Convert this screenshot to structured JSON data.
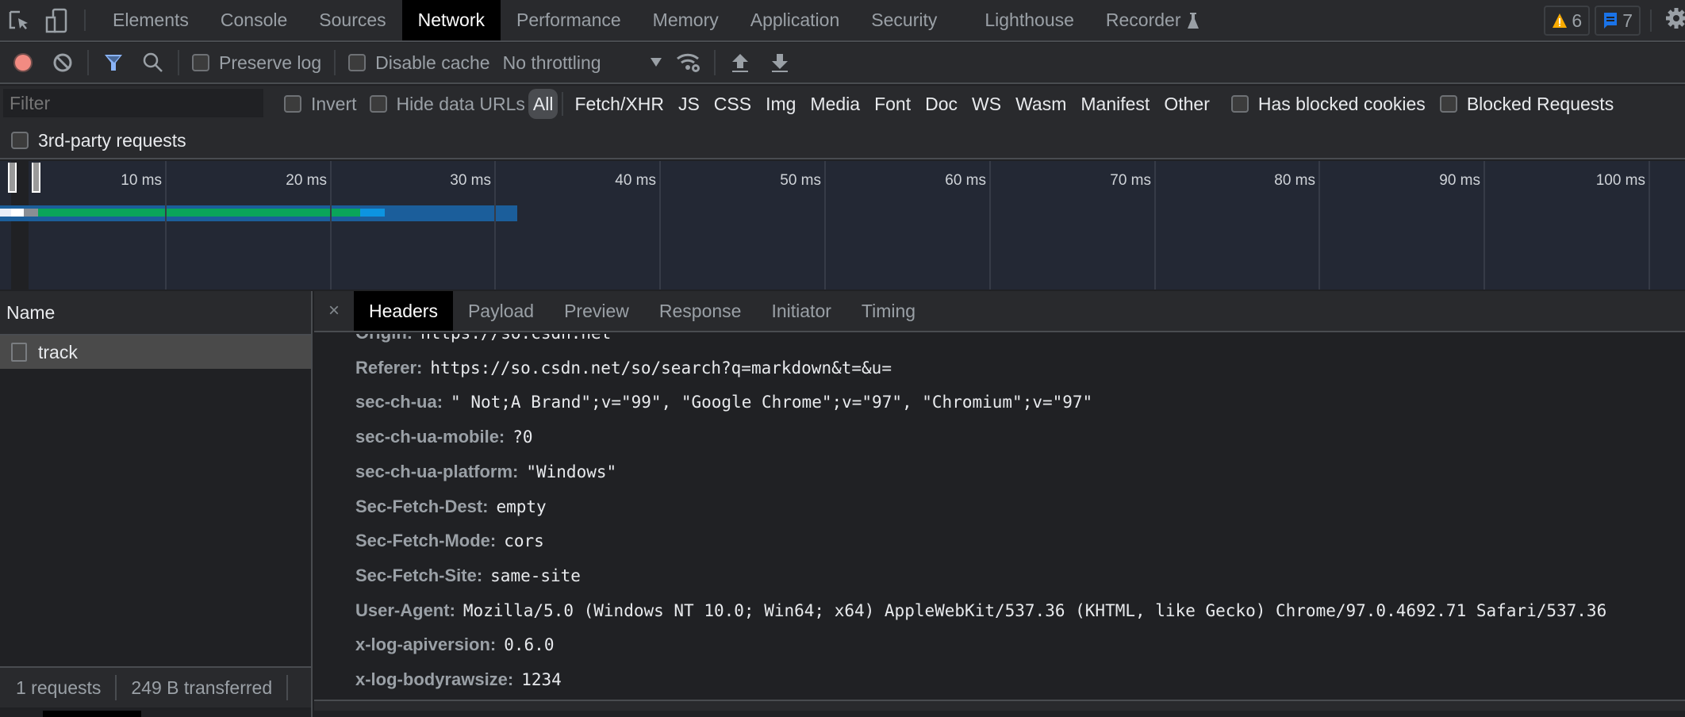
{
  "top_tabs": [
    {
      "label": "Elements",
      "active": false
    },
    {
      "label": "Console",
      "active": false
    },
    {
      "label": "Sources",
      "active": false
    },
    {
      "label": "Network",
      "active": true
    },
    {
      "label": "Performance",
      "active": false
    },
    {
      "label": "Memory",
      "active": false
    },
    {
      "label": "Application",
      "active": false
    },
    {
      "label": "Security",
      "active": false
    },
    {
      "label": "Lighthouse",
      "active": false
    },
    {
      "label": "Recorder",
      "active": false
    }
  ],
  "badges": {
    "warnings": "6",
    "messages": "7"
  },
  "toolbar": {
    "preserve_log": "Preserve log",
    "disable_cache": "Disable cache",
    "throttling": "No throttling"
  },
  "filter": {
    "placeholder": "Filter",
    "invert": "Invert",
    "hide_data_urls": "Hide data URLs",
    "types": [
      "All",
      "Fetch/XHR",
      "JS",
      "CSS",
      "Img",
      "Media",
      "Font",
      "Doc",
      "WS",
      "Wasm",
      "Manifest",
      "Other"
    ],
    "has_blocked_cookies": "Has blocked cookies",
    "blocked_requests": "Blocked Requests",
    "third_party": "3rd-party requests"
  },
  "overview": {
    "ticks": [
      "10 ms",
      "20 ms",
      "30 ms",
      "40 ms",
      "50 ms",
      "60 ms",
      "70 ms",
      "80 ms",
      "90 ms",
      "100 ms"
    ],
    "request_end_ms": 31.4
  },
  "requests": {
    "column_header": "Name",
    "rows": [
      {
        "name": "track"
      }
    ]
  },
  "status": {
    "requests": "1 requests",
    "transferred": "249 B transferred"
  },
  "detail_tabs": [
    "Headers",
    "Payload",
    "Preview",
    "Response",
    "Initiator",
    "Timing"
  ],
  "headers": [
    {
      "key": "Origin:",
      "value": "https://so.csdn.net"
    },
    {
      "key": "Referer:",
      "value": "https://so.csdn.net/so/search?q=markdown&t=&u="
    },
    {
      "key": "sec-ch-ua:",
      "value": "\" Not;A Brand\";v=\"99\", \"Google Chrome\";v=\"97\", \"Chromium\";v=\"97\""
    },
    {
      "key": "sec-ch-ua-mobile:",
      "value": "?0"
    },
    {
      "key": "sec-ch-ua-platform:",
      "value": "\"Windows\""
    },
    {
      "key": "Sec-Fetch-Dest:",
      "value": "empty"
    },
    {
      "key": "Sec-Fetch-Mode:",
      "value": "cors"
    },
    {
      "key": "Sec-Fetch-Site:",
      "value": "same-site"
    },
    {
      "key": "User-Agent:",
      "value": "Mozilla/5.0 (Windows NT 10.0; Win64; x64) AppleWebKit/537.36 (KHTML, like Gecko) Chrome/97.0.4692.71 Safari/537.36"
    },
    {
      "key": "x-log-apiversion:",
      "value": "0.6.0"
    },
    {
      "key": "x-log-bodyrawsize:",
      "value": "1234"
    }
  ]
}
